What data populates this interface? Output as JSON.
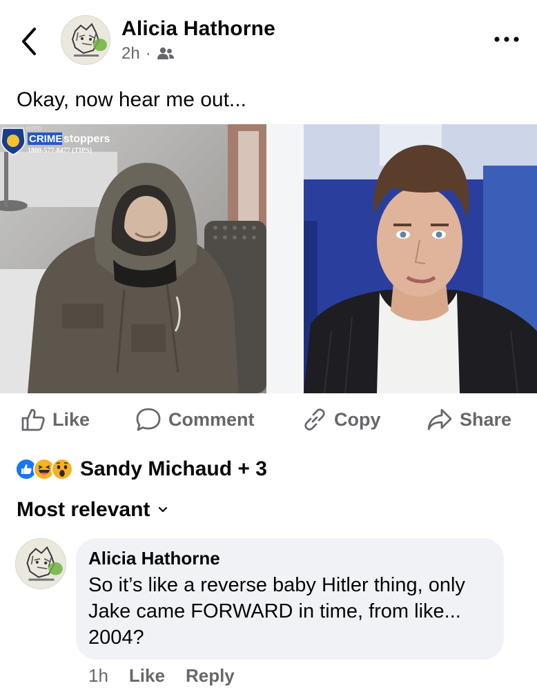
{
  "header": {
    "author": "Alicia Hathorne",
    "time": "2h",
    "separator": "·",
    "audience_icon": "friends-icon",
    "back_icon": "chevron-left-icon",
    "more_icon": "more-horizontal-icon"
  },
  "post": {
    "text": "Okay, now hear me out...",
    "left_photo": {
      "overlay_title_highlight": "CRIME",
      "overlay_title_rest": "stoppers",
      "overlay_phone": "1800-577-8477 (TIPS)",
      "overlay_nypd": "NYPD"
    }
  },
  "actions": {
    "like": "Like",
    "comment": "Comment",
    "copy": "Copy",
    "share": "Share"
  },
  "reactions": {
    "icons": [
      "like-reaction-icon",
      "haha-reaction-icon",
      "wow-reaction-icon"
    ],
    "text": "Sandy Michaud + 3"
  },
  "comments_sort": {
    "label": "Most relevant"
  },
  "comment": {
    "author": "Alicia Hathorne",
    "text": "So it’s like a reverse baby Hitler thing, only Jake came FORWARD in time, from like... 2004?",
    "time": "1h",
    "like": "Like",
    "reply": "Reply"
  },
  "colors": {
    "secondary_text": "#65676b",
    "bubble_bg": "#f0f2f5",
    "like_blue": "#1877f2",
    "reaction_yellow": "#f7b125"
  }
}
